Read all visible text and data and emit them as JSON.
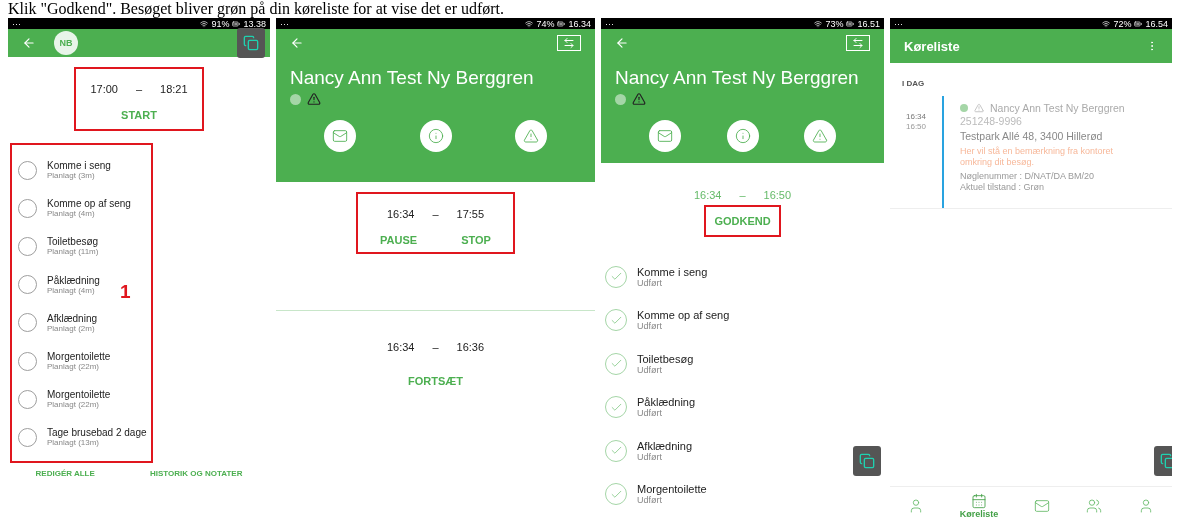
{
  "caption": "Klik \"Godkend\". Besøget bliver grøn på din køreliste for at vise det er udført.",
  "phones": [
    {
      "kind": "plan",
      "status": {
        "dots": "···",
        "battery": "91%",
        "time": "13.38"
      },
      "avatar": "NB",
      "start": "17:00",
      "dash": "–",
      "end": "18:21",
      "action": "START",
      "annotation": "1",
      "tasks": [
        {
          "name": "Komme i seng",
          "status": "Planlagt (3m)",
          "checked": false
        },
        {
          "name": "Komme op af seng",
          "status": "Planlagt (4m)",
          "checked": false
        },
        {
          "name": "Toiletbesøg",
          "status": "Planlagt (11m)",
          "checked": false
        },
        {
          "name": "Påklædning",
          "status": "Planlagt (4m)",
          "checked": false
        },
        {
          "name": "Afklædning",
          "status": "Planlagt (2m)",
          "checked": false
        },
        {
          "name": "Morgentoilette",
          "status": "Planlagt (22m)",
          "checked": false
        },
        {
          "name": "Morgentoilette",
          "status": "Planlagt (22m)",
          "checked": false
        },
        {
          "name": "Tage brusebad 2 dage",
          "status": "Planlagt (13m)",
          "checked": false
        }
      ],
      "footer": [
        "REDIGÉR ALLE",
        "HISTORIK OG NOTATER"
      ]
    },
    {
      "kind": "running",
      "status": {
        "dots": "···",
        "battery": "74%",
        "time": "16.34"
      },
      "name": "Nancy Ann Test Ny Berggren",
      "start": "16:34",
      "dash": "–",
      "end": "17:55",
      "actions": [
        "PAUSE",
        "STOP"
      ],
      "pause_start": "16:34",
      "pause_dash": "–",
      "pause_end": "16:36",
      "resume": "FORTSÆT"
    },
    {
      "kind": "done",
      "status": {
        "dots": "···",
        "battery": "73%",
        "time": "16.51"
      },
      "name": "Nancy Ann Test Ny Berggren",
      "start": "16:34",
      "dash": "–",
      "end": "16:50",
      "action": "GODKEND",
      "tasks": [
        {
          "name": "Komme i seng",
          "status": "Udført",
          "checked": true
        },
        {
          "name": "Komme op af seng",
          "status": "Udført",
          "checked": true
        },
        {
          "name": "Toiletbesøg",
          "status": "Udført",
          "checked": true
        },
        {
          "name": "Påklædning",
          "status": "Udført",
          "checked": true
        },
        {
          "name": "Afklædning",
          "status": "Udført",
          "checked": true
        },
        {
          "name": "Morgentoilette",
          "status": "Udført",
          "checked": true
        }
      ]
    },
    {
      "kind": "list",
      "status": {
        "dots": "···",
        "battery": "72%",
        "time": "16.54"
      },
      "title": "Køreliste",
      "section": "I DAG",
      "entry": {
        "start": "16:34",
        "end": "16:50",
        "name": "Nancy Ann Test Ny Berggren",
        "id": "251248-9996",
        "address": "Testpark Allé 48, 3400 Hillerød",
        "note": "Her vil stå en bemærkning fra kontoret omkring dit besøg.",
        "key": "Nøglenummer : D/NAT/DA BM/20",
        "state": "Aktuel tilstand : Grøn"
      },
      "nav": [
        {
          "kind": "person",
          "selected": false
        },
        {
          "kind": "calendar",
          "label": "Køreliste",
          "selected": true
        },
        {
          "kind": "mail",
          "selected": false
        },
        {
          "kind": "group",
          "selected": false
        },
        {
          "kind": "person",
          "selected": false
        }
      ]
    }
  ]
}
